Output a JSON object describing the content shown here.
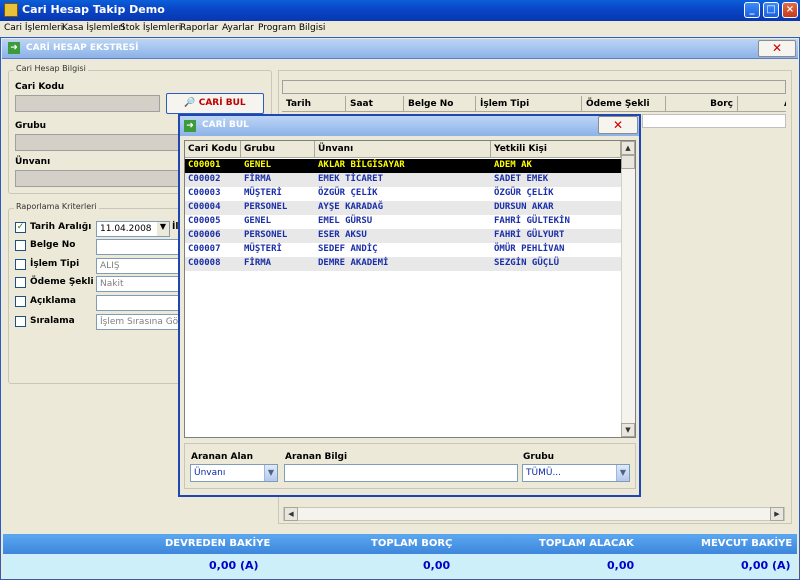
{
  "window": {
    "title": "Cari Hesap Takip Demo",
    "min": "_",
    "max": "□",
    "close": "×"
  },
  "menu": [
    "Cari İşlemleri",
    "Kasa İşlemleri",
    "Stok İşlemleri",
    "Raporlar",
    "Ayarlar",
    "Program Bilgisi"
  ],
  "form": {
    "title": "CARİ HESAP EKSTRESİ",
    "close_label": "✕",
    "group_cari": "Cari Hesap Bilgisi",
    "label_kod": "Cari Kodu",
    "label_grup": "Grubu",
    "label_unvan": "Ünvanı",
    "find_button": "CARİ BUL",
    "group_report": "Raporlama Kriterleri",
    "criteria": [
      {
        "label": "Tarih Aralığı",
        "checked": true,
        "value": "11.04.2008"
      },
      {
        "label": "Belge No",
        "checked": false,
        "value": ""
      },
      {
        "label": "İşlem Tipi",
        "checked": false,
        "value": "ALIŞ"
      },
      {
        "label": "Ödeme Şekli",
        "checked": false,
        "value": "Nakit"
      },
      {
        "label": "Açıklama",
        "checked": false,
        "value": ""
      },
      {
        "label": "Sıralama",
        "checked": false,
        "value": "İşlem Sırasına Göre"
      }
    ],
    "date_extra": "İl",
    "columns": [
      "Tarih",
      "Saat",
      "Belge No",
      "İşlem Tipi",
      "Ödeme Şekli",
      "Borç",
      "A"
    ]
  },
  "totals": {
    "labels": [
      "DEVREDEN BAKİYE",
      "TOPLAM BORÇ",
      "TOPLAM ALACAK",
      "MEVCUT BAKİYE"
    ],
    "values": [
      "0,00  (A)",
      "0,00",
      "0,00",
      "0,00  (A)"
    ]
  },
  "dialog": {
    "title": "CARİ BUL",
    "close_label": "✕",
    "columns": [
      "Cari Kodu",
      "Grubu",
      "Ünvanı",
      "Yetkili Kişi"
    ],
    "rows": [
      [
        "C00001",
        "GENEL",
        "AKLAR BİLGİSAYAR",
        "ADEM AK"
      ],
      [
        "C00002",
        "FİRMA",
        "EMEK TİCARET",
        "SADET EMEK"
      ],
      [
        "C00003",
        "MÜŞTERİ",
        "ÖZGÜR ÇELİK",
        "ÖZGÜR ÇELİK"
      ],
      [
        "C00004",
        "PERSONEL",
        "AYŞE KARADAĞ",
        "DURSUN AKAR"
      ],
      [
        "C00005",
        "GENEL",
        "EMEL GÜRSU",
        "FAHRİ GÜLTEKİN"
      ],
      [
        "C00006",
        "PERSONEL",
        "ESER AKSU",
        "FAHRİ GÜLYURT"
      ],
      [
        "C00007",
        "MÜŞTERİ",
        "SEDEF ANDİÇ",
        "ÖMÜR PEHLİVAN"
      ],
      [
        "C00008",
        "FİRMA",
        "DEMRE AKADEMİ",
        "SEZGİN GÜÇLÜ"
      ]
    ],
    "selected_row": 0,
    "search": {
      "field_label": "Aranan Alan",
      "field_value": "Ünvanı",
      "info_label": "Aranan Bilgi",
      "info_value": "",
      "group_label": "Grubu",
      "group_value": "TÜMÜ..."
    }
  }
}
